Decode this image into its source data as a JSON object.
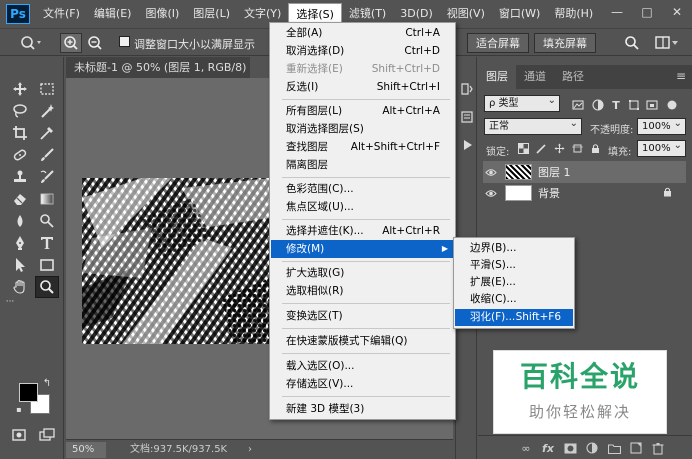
{
  "app": {
    "logo": "Ps"
  },
  "menubar": {
    "items": [
      "文件(F)",
      "编辑(E)",
      "图像(I)",
      "图层(L)",
      "文字(Y)",
      "选择(S)",
      "滤镜(T)",
      "3D(D)",
      "视图(V)",
      "窗口(W)",
      "帮助(H)"
    ],
    "active_index": 5
  },
  "window": {
    "minimize": "—",
    "maximize": "□",
    "close": "✕"
  },
  "options_bar": {
    "checkbox_label": "调整窗口大小以满屏显示",
    "fit_screen": "适合屏幕",
    "fill_screen": "填充屏幕"
  },
  "document": {
    "tab_title": "未标题-1 @ 50% (图层 1, RGB/8) *",
    "tab_close": "×",
    "zoom": "50%",
    "doc_info": "文档:937.5K/937.5K",
    "status_arrow": "›"
  },
  "select_menu": {
    "items": [
      {
        "label": "全部(A)",
        "shortcut": "Ctrl+A",
        "disabled": false
      },
      {
        "label": "取消选择(D)",
        "shortcut": "Ctrl+D",
        "disabled": false
      },
      {
        "label": "重新选择(E)",
        "shortcut": "Shift+Ctrl+D",
        "disabled": true
      },
      {
        "label": "反选(I)",
        "shortcut": "Shift+Ctrl+I",
        "disabled": false
      },
      {
        "label": "所有图层(L)",
        "shortcut": "Alt+Ctrl+A",
        "disabled": false
      },
      {
        "label": "取消选择图层(S)",
        "shortcut": "",
        "disabled": false
      },
      {
        "label": "查找图层",
        "shortcut": "Alt+Shift+Ctrl+F",
        "disabled": false
      },
      {
        "label": "隔离图层",
        "shortcut": "",
        "disabled": false
      },
      {
        "label": "色彩范围(C)...",
        "shortcut": "",
        "disabled": false
      },
      {
        "label": "焦点区域(U)...",
        "shortcut": "",
        "disabled": false
      },
      {
        "label": "选择并遮住(K)...",
        "shortcut": "Alt+Ctrl+R",
        "disabled": false
      },
      {
        "label": "修改(M)",
        "shortcut": "",
        "disabled": false
      },
      {
        "label": "扩大选取(G)",
        "shortcut": "",
        "disabled": false
      },
      {
        "label": "选取相似(R)",
        "shortcut": "",
        "disabled": false
      },
      {
        "label": "变换选区(T)",
        "shortcut": "",
        "disabled": false
      },
      {
        "label": "在快速蒙版模式下编辑(Q)",
        "shortcut": "",
        "disabled": false
      },
      {
        "label": "载入选区(O)...",
        "shortcut": "",
        "disabled": false
      },
      {
        "label": "存储选区(V)...",
        "shortcut": "",
        "disabled": false
      },
      {
        "label": "新建 3D 模型(3)",
        "shortcut": "",
        "disabled": false
      }
    ],
    "submenu_arrow": "▶"
  },
  "modify_submenu": {
    "items": [
      {
        "label": "边界(B)...",
        "shortcut": ""
      },
      {
        "label": "平滑(S)...",
        "shortcut": ""
      },
      {
        "label": "扩展(E)...",
        "shortcut": ""
      },
      {
        "label": "收缩(C)...",
        "shortcut": ""
      },
      {
        "label": "羽化(F)...",
        "shortcut": "Shift+F6"
      }
    ]
  },
  "layers_panel": {
    "tabs": [
      "图层",
      "通道",
      "路径"
    ],
    "filter_kind": "ρ 类型",
    "blend_mode": "正常",
    "opacity_label": "不透明度:",
    "opacity_value": "100%",
    "lock_label": "锁定:",
    "fill_label": "填充:",
    "fill_value": "100%",
    "layers": [
      {
        "name": "图层 1",
        "selected": true
      },
      {
        "name": "背景",
        "selected": false
      }
    ]
  },
  "watermark": {
    "title": "百科全说",
    "subtitle": "助你轻松解决"
  }
}
